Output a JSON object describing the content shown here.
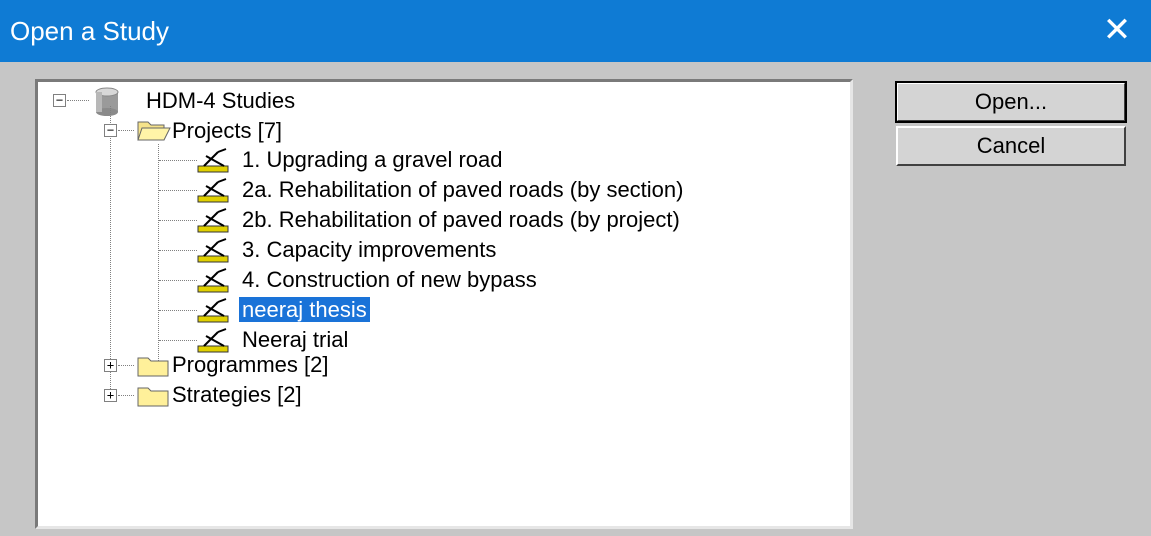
{
  "window": {
    "title": "Open a Study",
    "close_glyph": "✕"
  },
  "buttons": {
    "open": "Open...",
    "cancel": "Cancel"
  },
  "tree": {
    "root": {
      "label": "HDM-4 Studies",
      "icon": "database-icon"
    },
    "projects": {
      "label": "Projects [7]",
      "icon": "folder-open-icon",
      "items": [
        {
          "label": "1. Upgrading a gravel road"
        },
        {
          "label": "2a. Rehabilitation of paved roads (by section)"
        },
        {
          "label": "2b. Rehabilitation of paved roads (by project)"
        },
        {
          "label": "3. Capacity improvements"
        },
        {
          "label": "4. Construction of new bypass"
        },
        {
          "label": "neeraj thesis",
          "selected": true
        },
        {
          "label": "Neeraj trial"
        }
      ]
    },
    "programmes": {
      "label": "Programmes [2]",
      "icon": "folder-icon"
    },
    "strategies": {
      "label": "Strategies [2]",
      "icon": "folder-icon"
    }
  },
  "colors": {
    "titlebar": "#0f7bd4",
    "selection": "#1a73d8"
  }
}
